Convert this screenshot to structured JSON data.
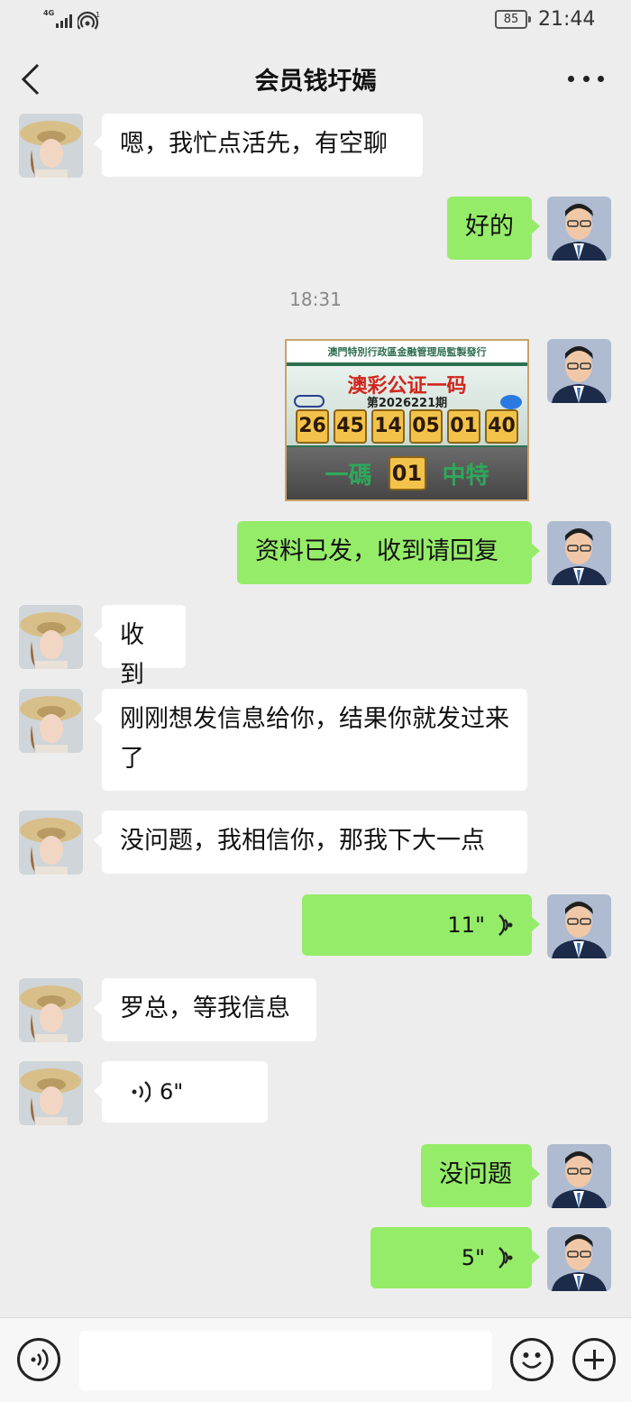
{
  "status_bar": {
    "network": "4G",
    "sim": "1",
    "battery": "85",
    "time": "21:44"
  },
  "header": {
    "title": "会员钱圩嫣",
    "back_icon": "chevron-left-icon",
    "more_icon": "more-dots-icon"
  },
  "messages": [
    {
      "side": "left",
      "text": "嗯，我忙点活先，有空聊"
    },
    {
      "side": "right",
      "text": "好的"
    },
    {
      "type": "time",
      "text": "18:31"
    },
    {
      "side": "right",
      "type": "image"
    },
    {
      "side": "right",
      "text": "资料已发，收到请回复"
    },
    {
      "side": "left",
      "text": "收到"
    },
    {
      "side": "left",
      "text": "刚刚想发信息给你，结果你就发过来了"
    },
    {
      "side": "left",
      "text": "没问题，我相信你，那我下大一点"
    },
    {
      "side": "right",
      "type": "voice",
      "duration": "11\""
    },
    {
      "side": "left",
      "text": "罗总，等我信息"
    },
    {
      "side": "left",
      "type": "voice",
      "duration": "6\""
    },
    {
      "side": "right",
      "text": "没问题"
    },
    {
      "side": "right",
      "type": "voice",
      "duration": "5\""
    }
  ],
  "lottery_image": {
    "band": "澳門特別行政區金融管理局監製發行",
    "headline": "澳彩公证一码",
    "issue": "第2026221期",
    "numbers": [
      "26",
      "45",
      "14",
      "05",
      "01",
      "40"
    ],
    "bottom_left": "一碼",
    "code": "01",
    "bottom_right": "中特"
  },
  "input_bar": {
    "voice_icon": "voice-mode-icon",
    "emoji_icon": "emoji-icon",
    "plus_icon": "plus-icon"
  },
  "colors": {
    "bubble_me": "#95ec69",
    "bubble_other": "#ffffff",
    "background": "#ededed"
  }
}
